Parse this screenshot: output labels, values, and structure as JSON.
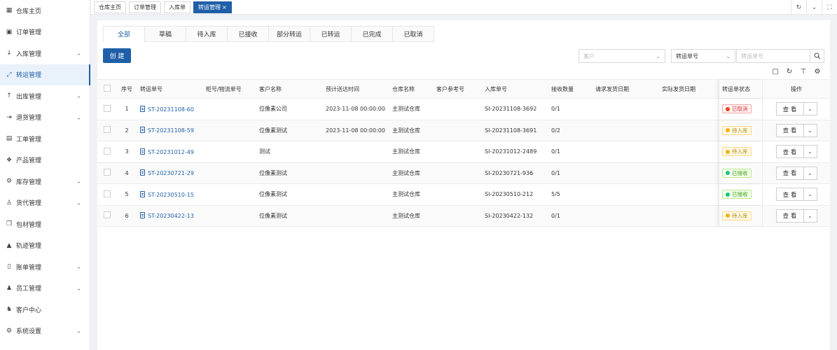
{
  "sidebar": {
    "items": [
      {
        "label": "仓库主页",
        "icon": "grid-icon",
        "glyph": "▦",
        "chevron": false
      },
      {
        "label": "订单管理",
        "icon": "order-icon",
        "glyph": "▣",
        "chevron": false
      },
      {
        "label": "入库管理",
        "icon": "arrow-down-icon",
        "glyph": "↓",
        "chevron": true
      },
      {
        "label": "转运管理",
        "icon": "transfer-icon",
        "glyph": "⤢",
        "chevron": false,
        "active": true
      },
      {
        "label": "出库管理",
        "icon": "arrow-up-icon",
        "glyph": "↑",
        "chevron": true
      },
      {
        "label": "退货管理",
        "icon": "return-icon",
        "glyph": "⇥",
        "chevron": true
      },
      {
        "label": "工单管理",
        "icon": "workorder-icon",
        "glyph": "▤",
        "chevron": false
      },
      {
        "label": "产品管理",
        "icon": "product-icon",
        "glyph": "❖",
        "chevron": false
      },
      {
        "label": "库存管理",
        "icon": "inventory-icon",
        "glyph": "⚙",
        "chevron": true
      },
      {
        "label": "货代管理",
        "icon": "forwarder-icon",
        "glyph": "♙",
        "chevron": true
      },
      {
        "label": "包材管理",
        "icon": "packaging-icon",
        "glyph": "❒",
        "chevron": false
      },
      {
        "label": "轨迹管理",
        "icon": "bell-icon",
        "glyph": "▲",
        "chevron": false
      },
      {
        "label": "账单管理",
        "icon": "bill-icon",
        "glyph": "▯",
        "chevron": true
      },
      {
        "label": "员工管理",
        "icon": "user-icon",
        "glyph": "♟",
        "chevron": true
      },
      {
        "label": "客户中心",
        "icon": "customer-icon",
        "glyph": "♞",
        "chevron": false
      },
      {
        "label": "系统设置",
        "icon": "settings-icon",
        "glyph": "⚙",
        "chevron": true
      }
    ]
  },
  "topbar": {
    "tabs": [
      {
        "label": "仓库主页",
        "active": false
      },
      {
        "label": "订单管理",
        "active": false
      },
      {
        "label": "入库单",
        "active": false
      },
      {
        "label": "转运管理",
        "active": true
      }
    ],
    "close_glyph": "×"
  },
  "status_tabs": [
    "全部",
    "草稿",
    "待入库",
    "已接收",
    "部分转运",
    "已转运",
    "已完成",
    "已取消"
  ],
  "create_label": "创 建",
  "filters": {
    "customer_placeholder": "客户",
    "field_value": "转运单号",
    "search_placeholder": "转运单号"
  },
  "table": {
    "headers": {
      "no": "序号",
      "code": "转运单号",
      "container": "柜号/物流单号",
      "customer": "客户名称",
      "eta": "预计送达时间",
      "warehouse": "仓库名称",
      "ref": "客户参考号",
      "inbound": "入库单号",
      "qty": "接收数量",
      "req_date": "请求发货日期",
      "act_date": "实际发货日期",
      "status": "转运单状态",
      "op": "操作"
    },
    "view_label": "查 看",
    "rows": [
      {
        "no": "1",
        "code": "ST-20231108-60",
        "container": "",
        "customer": "位像素公司",
        "eta": "2023-11-08 00:00:00",
        "warehouse": "主测试仓库",
        "ref": "",
        "inbound": "SI-20231108-3692",
        "qty": "0/1",
        "req_date": "",
        "act_date": "",
        "status": "已取消",
        "status_type": "cancel"
      },
      {
        "no": "2",
        "code": "ST-20231108-59",
        "container": "",
        "customer": "位像素测试",
        "eta": "2023-11-08 00:00:00",
        "warehouse": "主测试仓库",
        "ref": "",
        "inbound": "SI-20231108-3691",
        "qty": "0/2",
        "req_date": "",
        "act_date": "",
        "status": "待入库",
        "status_type": "pending"
      },
      {
        "no": "3",
        "code": "ST-20231012-49",
        "container": "",
        "customer": "测试",
        "eta": "",
        "warehouse": "主测试仓库",
        "ref": "",
        "inbound": "SI-20231012-2489",
        "qty": "0/1",
        "req_date": "",
        "act_date": "",
        "status": "待入库",
        "status_type": "pending"
      },
      {
        "no": "4",
        "code": "ST-20230721-29",
        "container": "",
        "customer": "位像素测试",
        "eta": "",
        "warehouse": "主测试仓库",
        "ref": "",
        "inbound": "SI-20230721-936",
        "qty": "0/1",
        "req_date": "",
        "act_date": "",
        "status": "已接收",
        "status_type": "received"
      },
      {
        "no": "5",
        "code": "ST-20230510-15",
        "container": "",
        "customer": "位像素测试",
        "eta": "",
        "warehouse": "主测试仓库",
        "ref": "",
        "inbound": "SI-20230510-212",
        "qty": "5/5",
        "req_date": "",
        "act_date": "",
        "status": "已接收",
        "status_type": "received"
      },
      {
        "no": "6",
        "code": "ST-20230422-13",
        "container": "",
        "customer": "位像素测试",
        "eta": "",
        "warehouse": "主测试仓库",
        "ref": "",
        "inbound": "SI-20230422-132",
        "qty": "0/1",
        "req_date": "",
        "act_date": "",
        "status": "待入库",
        "status_type": "pending"
      }
    ]
  },
  "colors": {
    "primary": "#1f5fa8",
    "cancel": "#e0481f",
    "pending": "#faad14",
    "received": "#13c28d"
  }
}
